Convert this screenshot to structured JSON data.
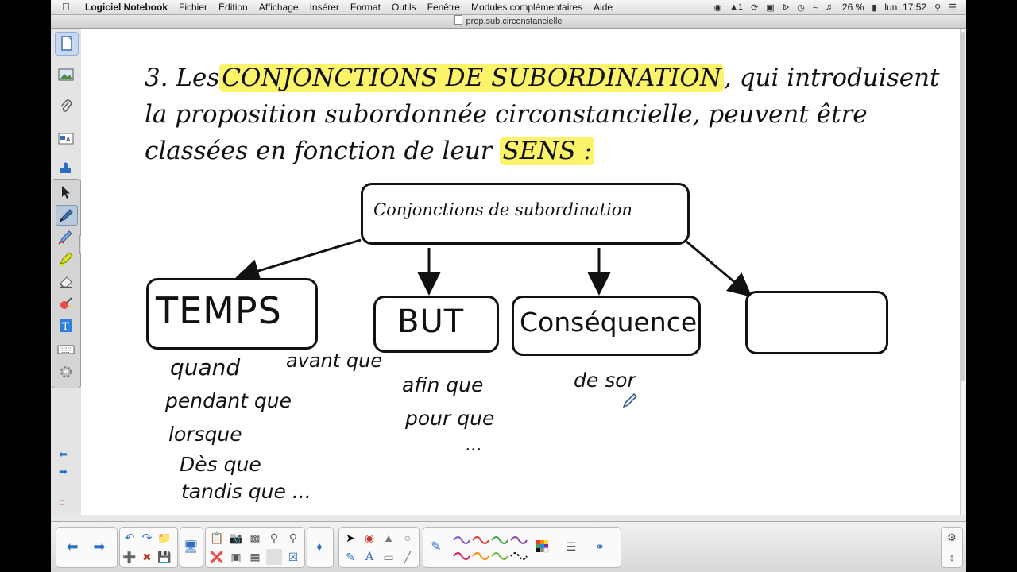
{
  "menubar": {
    "items": [
      "Logiciel Notebook",
      "Fichier",
      "Édition",
      "Affichage",
      "Insérer",
      "Format",
      "Outils",
      "Fenêtre",
      "Modules complémentaires",
      "Aide"
    ],
    "status": {
      "flag_number": "1",
      "battery": "26 %",
      "clock": "lun. 17:52"
    }
  },
  "window": {
    "title": "prop.sub.circonstancielle"
  },
  "page": {
    "title_lines": [
      {
        "before": "3. Les",
        "highlight": "CONJONCTIONS DE SUBORDINATION",
        "after": ", qui introduisent"
      },
      {
        "text": "la proposition subordonnée circonstancielle, peuvent être"
      },
      {
        "before": "classées en fonction de leur",
        "highlight": "SENS :",
        "after": ""
      }
    ],
    "root_box": "Conjonctions de subordination",
    "category_boxes": [
      "TEMPS",
      "BUT",
      "Conséquence",
      ""
    ],
    "handwriting": {
      "temps": [
        "quand",
        "avant que",
        "pendant que",
        "lorsque",
        "Dès que",
        "tandis que ..."
      ],
      "but": [
        "afin que",
        "pour que",
        "..."
      ],
      "consequence": [
        "de sor"
      ]
    }
  },
  "colors": {
    "highlight": "#fbf36a",
    "ink": "#111111",
    "canvas": "#ffffff"
  },
  "icons": {
    "side": [
      "page-sorter-icon",
      "gallery-icon",
      "attachments-icon",
      "properties-icon",
      "addons-icon"
    ],
    "tools": [
      "select-icon",
      "pen-icon",
      "creative-pen-icon",
      "highlighter-icon",
      "eraser-icon",
      "magic-pen-icon",
      "text-icon",
      "keyboard-icon",
      "settings-icon"
    ]
  }
}
